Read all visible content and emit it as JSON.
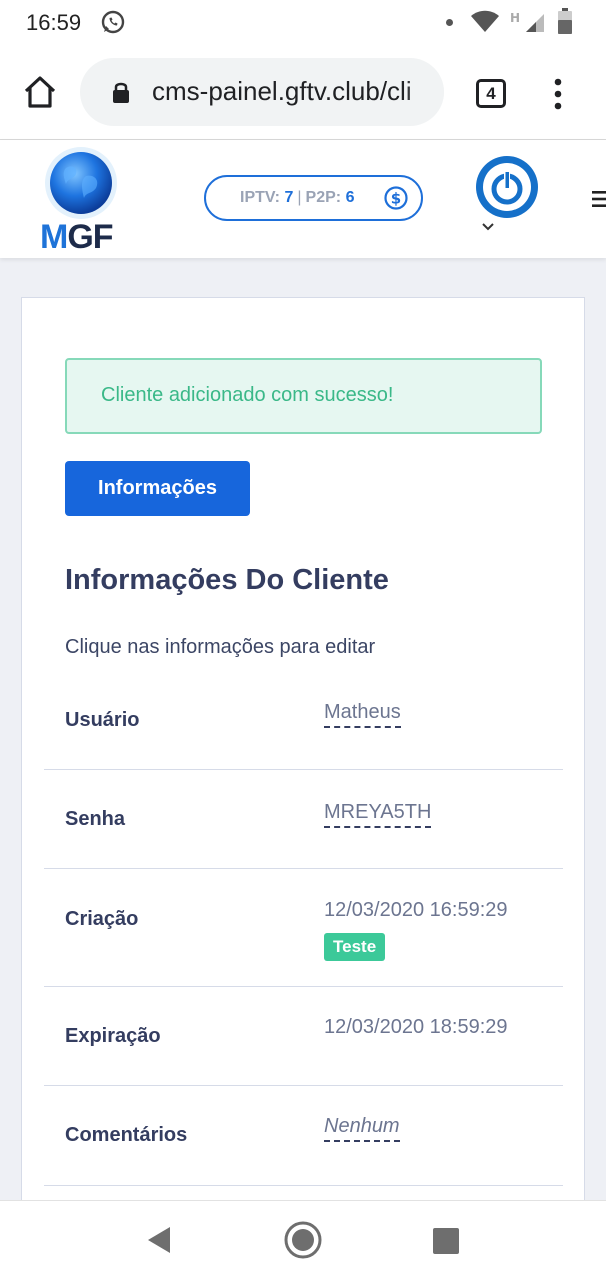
{
  "status_bar": {
    "time": "16:59",
    "icons": [
      "whatsapp-icon",
      "dot-icon",
      "wifi-icon",
      "signal-h-icon",
      "battery-icon"
    ]
  },
  "browser": {
    "url": "cms-painel.gftv.club/cli",
    "tab_count": "4",
    "icons": [
      "home-icon",
      "lock-icon",
      "more-vert-icon"
    ]
  },
  "header": {
    "logo_m": "M",
    "logo_gf": "GF",
    "iptv_label": "IPTV:",
    "iptv_value": "7",
    "separator": "|",
    "p2p_label": "P2P:",
    "p2p_value": "6",
    "colors": {
      "brand_blue": "#1e6fd9",
      "logo_dark": "#1d2b4a"
    }
  },
  "alert": {
    "message": "Cliente adicionado com sucesso!",
    "colors": {
      "background": "#e6f7f1",
      "border": "#86d9b9",
      "text": "#3ab888"
    }
  },
  "buttons": {
    "info_label": "Informações"
  },
  "client_section": {
    "title": "Informações Do Cliente",
    "hint": "Clique nas informações para editar",
    "rows": [
      {
        "label": "Usuário",
        "value": "Matheus"
      },
      {
        "label": "Senha",
        "value": "MREYA5TH"
      },
      {
        "label": "Criação",
        "value": "12/03/2020 16:59:29",
        "badge": "Teste"
      },
      {
        "label": "Expiração",
        "value": "12/03/2020 18:59:29"
      },
      {
        "label": "Comentários",
        "value": "Nenhum"
      }
    ]
  },
  "nav_bar": {
    "icons": [
      "back-icon",
      "home-circle-icon",
      "recents-icon"
    ]
  }
}
